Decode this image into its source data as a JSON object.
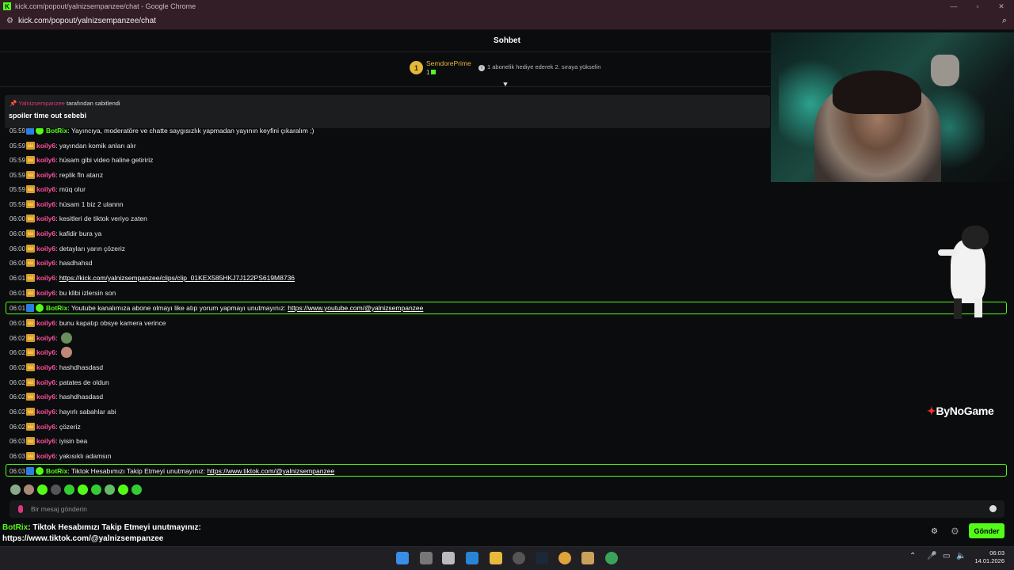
{
  "window": {
    "title": "kick.com/popout/yalnizsempanzee/chat - Google Chrome",
    "url": "kick.com/popout/yalnizsempanzee/chat",
    "app_icon": "K"
  },
  "chat": {
    "header": "Sohbet",
    "goal": {
      "rank": "1",
      "name": "SemdorePrime",
      "count": "1",
      "hint": "1 abonelik hediye ederek 2. sıraya yükselin"
    },
    "pinned": {
      "pinner": "Yalnizsempanzee",
      "by_text": "tarafından sabitlendi",
      "message": "spoiler time out sebebi"
    },
    "messages": [
      {
        "time": "05:59",
        "user": "BotRix",
        "text": ": Yayıncıya, moderatöre ve chatte saygısızlık yapmadan yayının keyfini çıkaralım ;)"
      },
      {
        "time": "05:59",
        "user": "koily6",
        "text": ": yayından komik anları alır"
      },
      {
        "time": "05:59",
        "user": "koily6",
        "text": ": hüsam gibi video haline getiririz"
      },
      {
        "time": "05:59",
        "user": "koily6",
        "text": ": replik fln atarız"
      },
      {
        "time": "05:59",
        "user": "koily6",
        "text": ": müq olur"
      },
      {
        "time": "05:59",
        "user": "koily6",
        "text": ": hüsam 1 biz 2 ulannn"
      },
      {
        "time": "06:00",
        "user": "koily6",
        "text": ": kesitleri de tiktok veriyo zaten"
      },
      {
        "time": "06:00",
        "user": "koily6",
        "text": ": kafidir bura ya"
      },
      {
        "time": "06:00",
        "user": "koily6",
        "text": ": detayları yarın çözeriz"
      },
      {
        "time": "06:00",
        "user": "koily6",
        "text": ": hasdhahsd"
      },
      {
        "time": "06:01",
        "user": "koily6",
        "text": ": ",
        "link": "https://kick.com/yalnizsempanzee/clips/clip_01KEX585HKJ7J122PS619M8736"
      },
      {
        "time": "06:01",
        "user": "koily6",
        "text": ": bu klibi izlersin son"
      },
      {
        "time": "06:01",
        "user": "BotRix",
        "text": ": Youtube kanalımıza abone olmayı like atıp yorum yapmayı unutmayınız: ",
        "link": "https://www.youtube.com/@yalnizsempanzee"
      },
      {
        "time": "06:01",
        "user": "koily6",
        "text": ": bunu kapatıp obsye kamera verince"
      },
      {
        "time": "06:02",
        "user": "koily6",
        "text": ": "
      },
      {
        "time": "06:02",
        "user": "koily6",
        "text": ": "
      },
      {
        "time": "06:02",
        "user": "koily6",
        "text": ": hashdhasdasd"
      },
      {
        "time": "06:02",
        "user": "koily6",
        "text": ": patates de oldun"
      },
      {
        "time": "06:02",
        "user": "koily6",
        "text": ": hashdhasdasd"
      },
      {
        "time": "06:02",
        "user": "koily6",
        "text": ": hayırlı sabahlar abi"
      },
      {
        "time": "06:02",
        "user": "koily6",
        "text": ": çözeriz"
      },
      {
        "time": "06:03",
        "user": "koily6",
        "text": ": iyisin bea"
      },
      {
        "time": "06:03",
        "user": "koily6",
        "text": ": yakısıklı adamsın"
      },
      {
        "time": "06:03",
        "user": "BotRix",
        "text": ": Tiktok Hesabımızı Takip Etmeyi unutmayınız: ",
        "link": "https://www.tiktok.com/@yalnizsempanzee"
      }
    ],
    "input_placeholder": "Bir mesaj gönderin",
    "send_label": "Gönder"
  },
  "overlay": {
    "brand": "ByNoGame",
    "toast_user": "BotRix",
    "toast_text": ": Tiktok Hesabımızı Takip Etmeyi unutmayınız:",
    "toast_link": "https://www.tiktok.com/@yalnizsempanzee"
  },
  "taskbar": {
    "time": "06:03",
    "date": "14.01.2026"
  },
  "colors": {
    "kick_green": "#53fc18",
    "username_pink": "#ff4fa0",
    "gold": "#e5b73b",
    "chrome_frame": "#331d26"
  }
}
